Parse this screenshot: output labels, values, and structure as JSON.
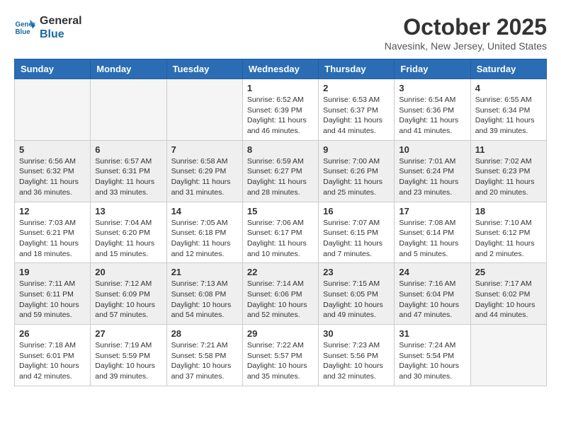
{
  "logo": {
    "line1": "General",
    "line2": "Blue"
  },
  "title": "October 2025",
  "location": "Navesink, New Jersey, United States",
  "weekdays": [
    "Sunday",
    "Monday",
    "Tuesday",
    "Wednesday",
    "Thursday",
    "Friday",
    "Saturday"
  ],
  "weeks": [
    [
      {
        "day": "",
        "info": ""
      },
      {
        "day": "",
        "info": ""
      },
      {
        "day": "",
        "info": ""
      },
      {
        "day": "1",
        "info": "Sunrise: 6:52 AM\nSunset: 6:39 PM\nDaylight: 11 hours\nand 46 minutes."
      },
      {
        "day": "2",
        "info": "Sunrise: 6:53 AM\nSunset: 6:37 PM\nDaylight: 11 hours\nand 44 minutes."
      },
      {
        "day": "3",
        "info": "Sunrise: 6:54 AM\nSunset: 6:36 PM\nDaylight: 11 hours\nand 41 minutes."
      },
      {
        "day": "4",
        "info": "Sunrise: 6:55 AM\nSunset: 6:34 PM\nDaylight: 11 hours\nand 39 minutes."
      }
    ],
    [
      {
        "day": "5",
        "info": "Sunrise: 6:56 AM\nSunset: 6:32 PM\nDaylight: 11 hours\nand 36 minutes."
      },
      {
        "day": "6",
        "info": "Sunrise: 6:57 AM\nSunset: 6:31 PM\nDaylight: 11 hours\nand 33 minutes."
      },
      {
        "day": "7",
        "info": "Sunrise: 6:58 AM\nSunset: 6:29 PM\nDaylight: 11 hours\nand 31 minutes."
      },
      {
        "day": "8",
        "info": "Sunrise: 6:59 AM\nSunset: 6:27 PM\nDaylight: 11 hours\nand 28 minutes."
      },
      {
        "day": "9",
        "info": "Sunrise: 7:00 AM\nSunset: 6:26 PM\nDaylight: 11 hours\nand 25 minutes."
      },
      {
        "day": "10",
        "info": "Sunrise: 7:01 AM\nSunset: 6:24 PM\nDaylight: 11 hours\nand 23 minutes."
      },
      {
        "day": "11",
        "info": "Sunrise: 7:02 AM\nSunset: 6:23 PM\nDaylight: 11 hours\nand 20 minutes."
      }
    ],
    [
      {
        "day": "12",
        "info": "Sunrise: 7:03 AM\nSunset: 6:21 PM\nDaylight: 11 hours\nand 18 minutes."
      },
      {
        "day": "13",
        "info": "Sunrise: 7:04 AM\nSunset: 6:20 PM\nDaylight: 11 hours\nand 15 minutes."
      },
      {
        "day": "14",
        "info": "Sunrise: 7:05 AM\nSunset: 6:18 PM\nDaylight: 11 hours\nand 12 minutes."
      },
      {
        "day": "15",
        "info": "Sunrise: 7:06 AM\nSunset: 6:17 PM\nDaylight: 11 hours\nand 10 minutes."
      },
      {
        "day": "16",
        "info": "Sunrise: 7:07 AM\nSunset: 6:15 PM\nDaylight: 11 hours\nand 7 minutes."
      },
      {
        "day": "17",
        "info": "Sunrise: 7:08 AM\nSunset: 6:14 PM\nDaylight: 11 hours\nand 5 minutes."
      },
      {
        "day": "18",
        "info": "Sunrise: 7:10 AM\nSunset: 6:12 PM\nDaylight: 11 hours\nand 2 minutes."
      }
    ],
    [
      {
        "day": "19",
        "info": "Sunrise: 7:11 AM\nSunset: 6:11 PM\nDaylight: 10 hours\nand 59 minutes."
      },
      {
        "day": "20",
        "info": "Sunrise: 7:12 AM\nSunset: 6:09 PM\nDaylight: 10 hours\nand 57 minutes."
      },
      {
        "day": "21",
        "info": "Sunrise: 7:13 AM\nSunset: 6:08 PM\nDaylight: 10 hours\nand 54 minutes."
      },
      {
        "day": "22",
        "info": "Sunrise: 7:14 AM\nSunset: 6:06 PM\nDaylight: 10 hours\nand 52 minutes."
      },
      {
        "day": "23",
        "info": "Sunrise: 7:15 AM\nSunset: 6:05 PM\nDaylight: 10 hours\nand 49 minutes."
      },
      {
        "day": "24",
        "info": "Sunrise: 7:16 AM\nSunset: 6:04 PM\nDaylight: 10 hours\nand 47 minutes."
      },
      {
        "day": "25",
        "info": "Sunrise: 7:17 AM\nSunset: 6:02 PM\nDaylight: 10 hours\nand 44 minutes."
      }
    ],
    [
      {
        "day": "26",
        "info": "Sunrise: 7:18 AM\nSunset: 6:01 PM\nDaylight: 10 hours\nand 42 minutes."
      },
      {
        "day": "27",
        "info": "Sunrise: 7:19 AM\nSunset: 5:59 PM\nDaylight: 10 hours\nand 39 minutes."
      },
      {
        "day": "28",
        "info": "Sunrise: 7:21 AM\nSunset: 5:58 PM\nDaylight: 10 hours\nand 37 minutes."
      },
      {
        "day": "29",
        "info": "Sunrise: 7:22 AM\nSunset: 5:57 PM\nDaylight: 10 hours\nand 35 minutes."
      },
      {
        "day": "30",
        "info": "Sunrise: 7:23 AM\nSunset: 5:56 PM\nDaylight: 10 hours\nand 32 minutes."
      },
      {
        "day": "31",
        "info": "Sunrise: 7:24 AM\nSunset: 5:54 PM\nDaylight: 10 hours\nand 30 minutes."
      },
      {
        "day": "",
        "info": ""
      }
    ]
  ]
}
